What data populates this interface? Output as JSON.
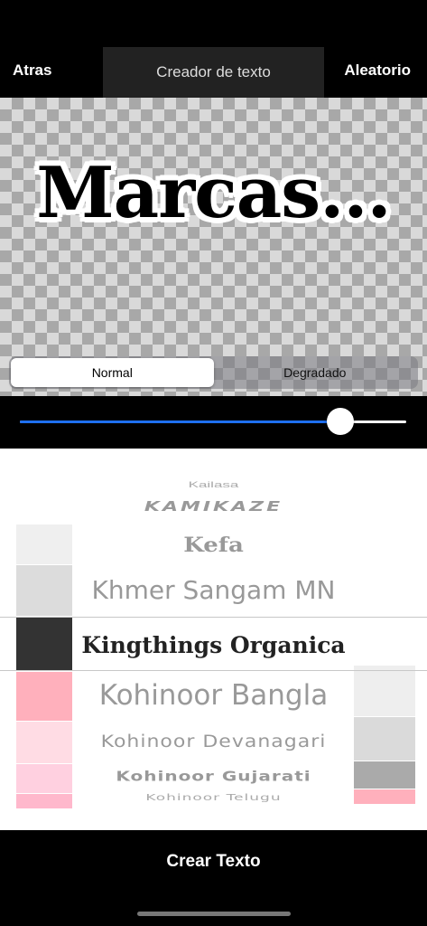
{
  "nav": {
    "back_label": "Atras",
    "title": "Creador de texto",
    "random_label": "Aleatorio"
  },
  "preview": {
    "text": "Marcas..."
  },
  "segment": {
    "options": [
      "Normal",
      "Degradado"
    ],
    "selected": "Normal"
  },
  "slider": {
    "value_fraction": 0.83,
    "accent": "#1e6ff0"
  },
  "font_picker": {
    "fonts": [
      "Kailasa",
      "KAMIKAZE",
      "Kefa",
      "Khmer Sangam MN",
      "Kingthings Organica",
      "Kohinoor Bangla",
      "Kohinoor Devanagari",
      "Kohinoor Gujarati",
      "Kohinoor Telugu"
    ],
    "selected": "Kingthings Organica"
  },
  "color_picker": {
    "left_swatches": [
      "#efefef",
      "#dcdcdc",
      "#333333",
      "#ffb0bc",
      "#ffdce4",
      "#ffd0e0",
      "#ffb8cc"
    ],
    "right_swatches": [
      "#eeeeee",
      "#dadada",
      "#aaaaaa",
      "#ffb0bc"
    ],
    "selected": "#333333"
  },
  "footer": {
    "create_label": "Crear Texto"
  }
}
